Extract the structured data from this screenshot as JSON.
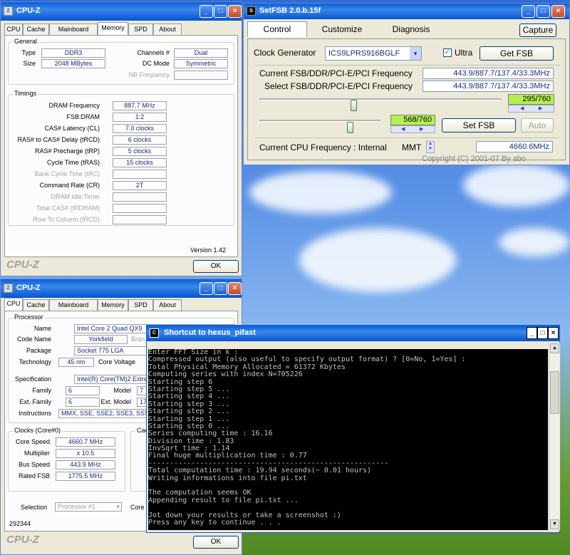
{
  "cpuz_memory": {
    "title": "CPU-Z",
    "tabs": [
      "CPU",
      "Cache",
      "Mainboard",
      "Memory",
      "SPD",
      "About"
    ],
    "active_tab": 3,
    "general_group": "General",
    "type_label": "Type",
    "type_value": "DDR3",
    "size_label": "Size",
    "size_value": "2048 MBytes",
    "channels_label": "Channels #",
    "channels_value": "Dual",
    "dcmode_label": "DC Mode",
    "dcmode_value": "Symmetric",
    "nbfreq_label": "NB Frequency",
    "nbfreq_value": "",
    "timings_group": "Timings",
    "timings": [
      {
        "label": "DRAM Frequency",
        "value": "887.7 MHz",
        "disabled": false
      },
      {
        "label": "FSB:DRAM",
        "value": "1:2",
        "disabled": false
      },
      {
        "label": "CAS# Latency (CL)",
        "value": "7.0 clocks",
        "disabled": false
      },
      {
        "label": "RAS# to CAS# Delay (tRCD)",
        "value": "6 clocks",
        "disabled": false
      },
      {
        "label": "RAS# Precharge (tRP)",
        "value": "5 clocks",
        "disabled": false
      },
      {
        "label": "Cycle Time (tRAS)",
        "value": "15 clocks",
        "disabled": false
      },
      {
        "label": "Bank Cycle Time (tRC)",
        "value": "",
        "disabled": true
      },
      {
        "label": "Command Rate (CR)",
        "value": "2T",
        "disabled": false
      },
      {
        "label": "DRAM Idle Timer",
        "value": "",
        "disabled": true
      },
      {
        "label": "Total CAS# (tRDRAM)",
        "value": "",
        "disabled": true
      },
      {
        "label": "Row To Column (tRCD)",
        "value": "",
        "disabled": true
      }
    ],
    "version": "Version 1.42",
    "brand": "CPU-Z",
    "ok_label": "OK"
  },
  "cpuz_cpu": {
    "title": "CPU-Z",
    "tabs": [
      "CPU",
      "Cache",
      "Mainboard",
      "Memory",
      "SPD",
      "About"
    ],
    "active_tab": 0,
    "processor_group": "Processor",
    "name_label": "Name",
    "name_value": "Intel Core 2 Quad QX9",
    "codename_label": "Code Name",
    "codename_value": "Yorkfield",
    "brand_partial": "Bran",
    "package_label": "Package",
    "package_value": "Socket 775 LGA",
    "technology_label": "Technology",
    "technology_value": "45 nm",
    "corevoltage_label": "Core Voltage",
    "spec_label": "Specification",
    "spec_value": "Intel(R) Core(TM)2 Extreme",
    "family_label": "Family",
    "family_value": "6",
    "model_label": "Model",
    "model_value": "7",
    "extfamily_label": "Ext. Family",
    "extfamily_value": "6",
    "extmodel_label": "Ext. Model",
    "extmodel_value": "17",
    "instr_label": "Instructions",
    "instr_value": "MMX, SSE, SSE2, SSE3, SSSE",
    "clocks_group": "Clocks (Core#0)",
    "cache_group_partial": "Cac",
    "corespeed_label": "Core Speed",
    "corespeed_value": "4660.7 MHz",
    "multiplier_label": "Multiplier",
    "multiplier_value": "x 10.5",
    "busspeed_label": "Bus Speed",
    "busspeed_value": "443.9 MHz",
    "ratedfsb_label": "Rated FSB",
    "ratedfsb_value": "1775.5 MHz",
    "selection_label": "Selection",
    "selection_value": "Processor #1",
    "cores_partial": "Core",
    "id_value": "292344",
    "brand": "CPU-Z",
    "ok_label": "OK"
  },
  "setfsb": {
    "title": "SetFSB 2.0.b.15f",
    "tabs": [
      "Control",
      "Customize",
      "Diagnosis"
    ],
    "capture_label": "Capture",
    "clockgen_label": "Clock Generator",
    "clockgen_value": "ICS9LPRS916BGLF",
    "ultra_label": "Ultra",
    "ultra_checked": true,
    "getfsb_label": "Get FSB",
    "current_freq_label": "Current FSB/DDR/PCI-E/PCI Frequency",
    "current_freq_value": "443.9/887.7/137.4/33.3MHz",
    "select_freq_label": "Select FSB/DDR/PCI-E/PCI Frequency",
    "select_freq_value": "443.9/887.7/137.4/33.3MHz",
    "slider1_value": "295/760",
    "slider1_fraction": 0.388,
    "slider2_value": "568/760",
    "slider2_fraction": 0.747,
    "setfsb_label": "Set FSB",
    "auto_label": "Auto",
    "cpu_freq_label": "Current CPU Frequency : Internal",
    "cpu_freq_mode": "MMT",
    "cpu_freq_value": "4660.6MHz",
    "copyright": "Copyright (C) 2001-07 By abo"
  },
  "console": {
    "title": "Shortcut to hexus_pifast",
    "lines": [
      "Enter FFT Size in k :",
      "Compressed output (also useful to specify output format) ? [0=No, 1=Yes] :",
      "Total Physical Memory Allocated = 61372 Kbytes",
      "Computing series with index N=705226",
      "Starting step 6",
      "Starting step 5 ...",
      "Starting step 4 ...",
      "Starting step 3 ...",
      "Starting step 2 ...",
      "Starting step 1 ...",
      "Starting step 0 ...",
      "Series computing time : 16.16",
      "Division time : 1.83",
      "InvSqrt time : 1.14",
      "Final huge multiplication time : 0.77",
      "--------------------------------------------------------",
      "Total computation time : 19.94 seconds(~ 0.01 hours)",
      "Writing informations into file pi.txt",
      "",
      "The computation seems OK",
      "Appending result to file pi.txt ...",
      "",
      "Jot down your results or take a screenshot :)",
      "Press any key to continue . . ."
    ]
  },
  "colors": {
    "accent": "#0a5fd8",
    "fsb_value": "#b4f050"
  }
}
